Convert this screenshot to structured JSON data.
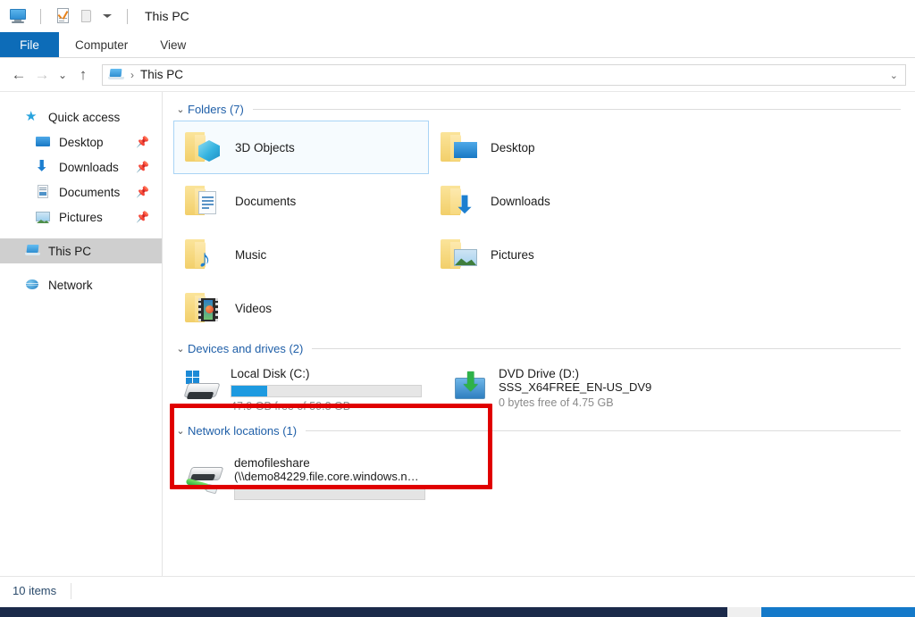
{
  "window": {
    "title": "This PC",
    "quick_access_toolbar": [
      {
        "name": "this-pc-icon",
        "label": "This PC"
      },
      {
        "name": "properties-icon",
        "label": "Properties"
      },
      {
        "name": "new-folder-icon",
        "label": "New folder"
      },
      {
        "name": "customize-dropdown-icon",
        "label": "Customize Quick Access Toolbar"
      }
    ]
  },
  "ribbon": {
    "tabs": [
      {
        "label": "File",
        "active": true
      },
      {
        "label": "Computer",
        "active": false
      },
      {
        "label": "View",
        "active": false
      }
    ]
  },
  "navbar": {
    "back_label": "←",
    "forward_label": "→",
    "recent_label": "⌄",
    "up_label": "↑",
    "address": {
      "icon": "this-pc-icon",
      "separator": "›",
      "path_text": "This PC",
      "dropdown": "⌄"
    }
  },
  "sidebar": {
    "items": [
      {
        "label": "Quick access",
        "icon": "star-icon",
        "level": 0,
        "pinned": false,
        "selected": false
      },
      {
        "label": "Desktop",
        "icon": "desktop-icon",
        "level": 1,
        "pinned": true,
        "selected": false
      },
      {
        "label": "Downloads",
        "icon": "downloads-icon",
        "level": 1,
        "pinned": true,
        "selected": false
      },
      {
        "label": "Documents",
        "icon": "documents-icon",
        "level": 1,
        "pinned": true,
        "selected": false
      },
      {
        "label": "Pictures",
        "icon": "pictures-icon",
        "level": 1,
        "pinned": true,
        "selected": false
      },
      {
        "label": "This PC",
        "icon": "this-pc-icon",
        "level": 0,
        "pinned": false,
        "selected": true
      },
      {
        "label": "Network",
        "icon": "network-icon",
        "level": 0,
        "pinned": false,
        "selected": false
      }
    ],
    "pin_glyph": "📌"
  },
  "content": {
    "groups": {
      "folders": {
        "title": "Folders (7)",
        "chevron": "⌄",
        "items": [
          {
            "label": "3D Objects",
            "icon": "folder-3d-objects-icon",
            "selected": true
          },
          {
            "label": "Desktop",
            "icon": "folder-desktop-icon",
            "selected": false
          },
          {
            "label": "Documents",
            "icon": "folder-documents-icon",
            "selected": false
          },
          {
            "label": "Downloads",
            "icon": "folder-downloads-icon",
            "selected": false
          },
          {
            "label": "Music",
            "icon": "folder-music-icon",
            "selected": false
          },
          {
            "label": "Pictures",
            "icon": "folder-pictures-icon",
            "selected": false
          },
          {
            "label": "Videos",
            "icon": "folder-videos-icon",
            "selected": false
          }
        ]
      },
      "devices": {
        "title": "Devices and drives (2)",
        "chevron": "⌄",
        "items": [
          {
            "name": "Local Disk (C:)",
            "icon": "local-disk-icon",
            "free_text": "47.9 GB free of 59.3 GB",
            "used_percent": 19,
            "has_bar": true,
            "subtitle": ""
          },
          {
            "name": "DVD Drive (D:)",
            "icon": "dvd-drive-icon",
            "subtitle": "SSS_X64FREE_EN-US_DV9",
            "free_text": "0 bytes free of 4.75 GB",
            "has_bar": false,
            "used_percent": 100
          }
        ]
      },
      "network": {
        "title": "Network locations (1)",
        "chevron": "⌄",
        "items": [
          {
            "name": "demofileshare",
            "icon": "network-drive-icon",
            "subtitle": "(\\\\demo84229.file.core.windows.n…",
            "has_bar": true,
            "used_percent": 0,
            "free_text": ""
          }
        ]
      }
    }
  },
  "annotation": {
    "highlight_color": "#e00000",
    "target": "demofileshare network location"
  },
  "statusbar": {
    "item_count": "10 items"
  },
  "colors": {
    "accent": "#0d6cb8",
    "group_header": "#1f5fa8",
    "selection_border": "#a9d4f5",
    "progress_fill": "#1e9ae0",
    "taskbar": "#1b2a4a"
  }
}
